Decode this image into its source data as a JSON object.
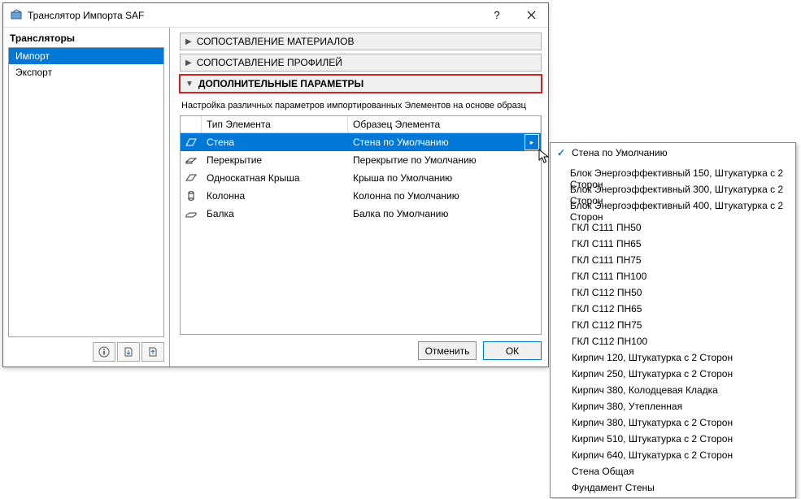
{
  "title": "Транслятор Импорта SAF",
  "sidebar": {
    "header": "Трансляторы",
    "items": [
      {
        "label": "Импорт",
        "selected": true
      },
      {
        "label": "Экспорт",
        "selected": false
      }
    ]
  },
  "sections": {
    "materials": "СОПОСТАВЛЕНИЕ МАТЕРИАЛОВ",
    "profiles": "СОПОСТАВЛЕНИЕ ПРОФИЛЕЙ",
    "params": "ДОПОЛНИТЕЛЬНЫЕ ПАРАМЕТРЫ"
  },
  "desc": "Настройка различных параметров импортированных Элементов на основе образц",
  "table": {
    "col1": "Тип Элемента",
    "col2": "Образец Элемента",
    "rows": [
      {
        "icon": "wall",
        "type": "Стена",
        "sample": "Стена по Умолчанию",
        "selected": true
      },
      {
        "icon": "slab",
        "type": "Перекрытие",
        "sample": "Перекрытие по Умолчанию",
        "selected": false
      },
      {
        "icon": "roof",
        "type": "Односкатная Крыша",
        "sample": "Крыша по Умолчанию",
        "selected": false
      },
      {
        "icon": "column",
        "type": "Колонна",
        "sample": "Колонна по Умолчанию",
        "selected": false
      },
      {
        "icon": "beam",
        "type": "Балка",
        "sample": "Балка по Умолчанию",
        "selected": false
      }
    ]
  },
  "buttons": {
    "cancel": "Отменить",
    "ok": "ОК"
  },
  "popup": {
    "selected": "Стена по Умолчанию",
    "items": [
      "Блок Энергоэффективный 150, Штукатурка с 2 Сторон",
      "Блок Энергоэффективный 300, Штукатурка с 2 Сторон",
      "Блок Энергоэффективный 400, Штукатурка с 2 Сторон",
      "ГКЛ С111 ПН50",
      "ГКЛ С111 ПН65",
      "ГКЛ С111 ПН75",
      "ГКЛ С111 ПН100",
      "ГКЛ С112 ПН50",
      "ГКЛ С112 ПН65",
      "ГКЛ С112 ПН75",
      "ГКЛ С112 ПН100",
      "Кирпич 120, Штукатурка с 2 Сторон",
      "Кирпич 250, Штукатурка с 2 Сторон",
      "Кирпич 380, Колодцевая Кладка",
      "Кирпич 380, Утепленная",
      "Кирпич 380, Штукатурка с 2 Сторон",
      "Кирпич 510, Штукатурка с 2 Сторон",
      "Кирпич 640, Штукатурка с 2 Сторон",
      "Стена Общая",
      "Фундамент Стены"
    ]
  }
}
